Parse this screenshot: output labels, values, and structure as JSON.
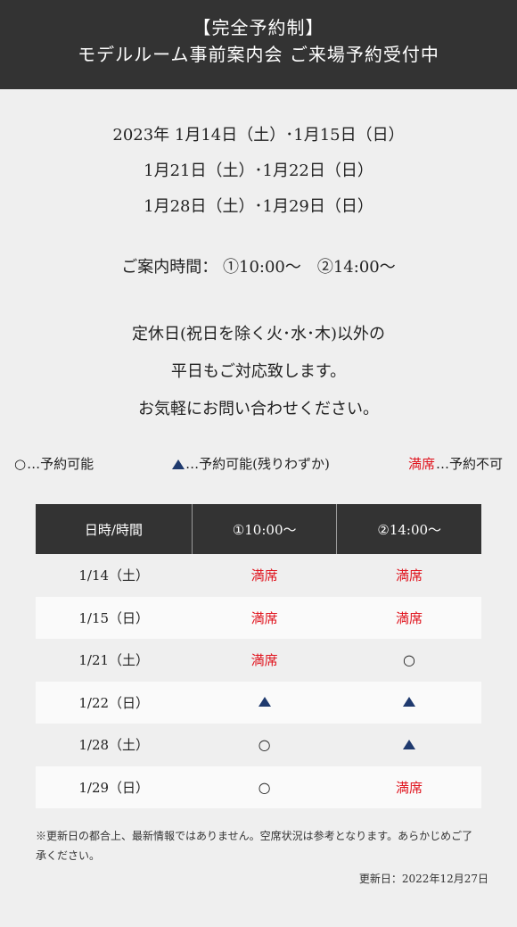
{
  "header": {
    "line1": "【完全予約制】",
    "line2": "モデルルーム事前案内会 ご来場予約受付中"
  },
  "dates": [
    "2023年 1月14日（土）･1月15日（日）",
    "1月21日（土）･1月22日（日）",
    "1月28日（土）･1月29日（日）"
  ],
  "hours": "ご案内時間： ①10:00～　②14:00～",
  "notice": [
    "定休日(祝日を除く火･水･木)以外の",
    "平日もご対応致します。",
    "お気軽にお問い合わせください。"
  ],
  "legend": {
    "circle_symbol": "○",
    "circle_label": "…予約可能",
    "triangle_label": "…予約可能(残りわずか)",
    "full_symbol": "満席",
    "full_label": "…予約不可"
  },
  "table": {
    "headers": [
      "日時/時間",
      "①10:00～",
      "②14:00～"
    ],
    "rows": [
      {
        "date": "1/14（土）",
        "slots": [
          "full",
          "full"
        ]
      },
      {
        "date": "1/15（日）",
        "slots": [
          "full",
          "full"
        ]
      },
      {
        "date": "1/21（土）",
        "slots": [
          "full",
          "circle"
        ]
      },
      {
        "date": "1/22（日）",
        "slots": [
          "triangle",
          "triangle"
        ]
      },
      {
        "date": "1/28（土）",
        "slots": [
          "circle",
          "triangle"
        ]
      },
      {
        "date": "1/29（日）",
        "slots": [
          "circle",
          "full"
        ]
      }
    ]
  },
  "footnote": "※更新日の都合上、最新情報ではありません。空席状況は参考となります。あらかじめご了承ください。",
  "updated": "更新日：2022年12月27日",
  "colors": {
    "header_bg": "#333333",
    "full_red": "#e0141e",
    "triangle_navy": "#1f3a6e",
    "body_bg": "#efefef"
  }
}
